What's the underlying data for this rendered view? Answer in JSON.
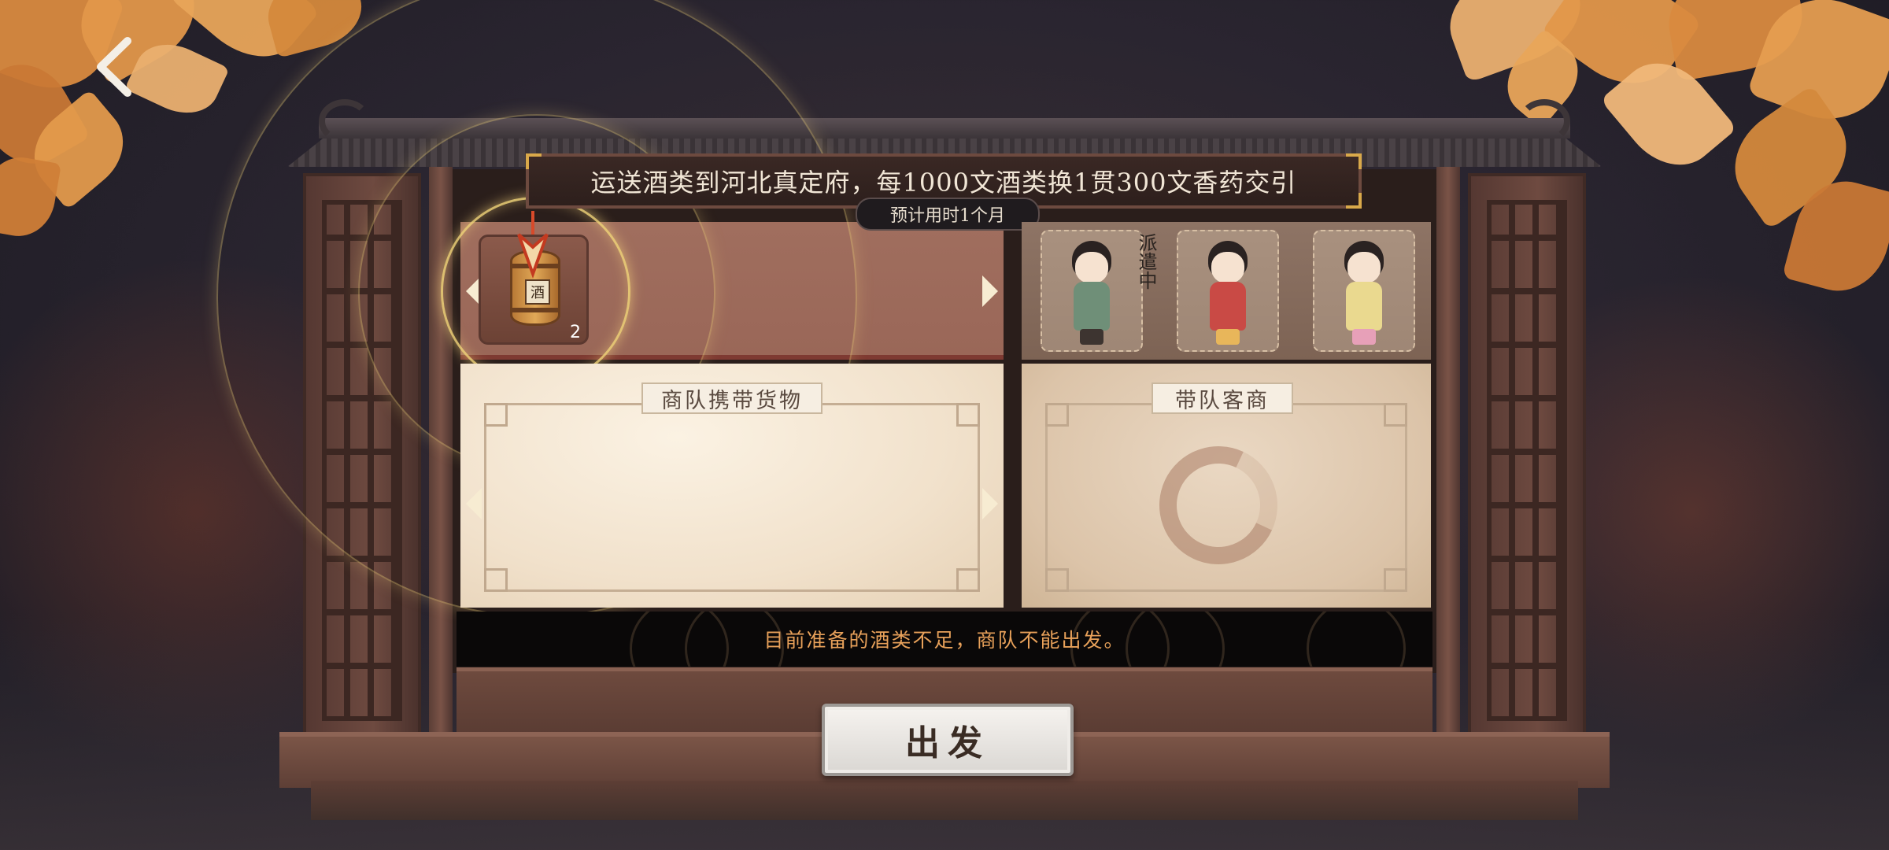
{
  "quest": {
    "title": "运送酒类到河北真定府，每1000文酒类换1贯300文香药交引",
    "duration": "预计用时1个月"
  },
  "goods_selector": {
    "selected_item": {
      "icon": "wine-barrel-icon",
      "label": "酒",
      "count": "2"
    }
  },
  "merchants": [
    {
      "name": "merchant-1",
      "status": "派遣中",
      "color": "#6f8f78"
    },
    {
      "name": "merchant-2",
      "status": "",
      "color": "#c94a45"
    },
    {
      "name": "merchant-3",
      "status": "",
      "color": "#ead98f"
    }
  ],
  "panels": {
    "cargo_label": "商队携带货物",
    "merchant_label": "带队客商"
  },
  "status": {
    "message": "目前准备的酒类不足，商队不能出发。"
  },
  "actions": {
    "depart_label": "出发"
  },
  "colors": {
    "accent_orange": "#e8a15a",
    "wood": "#6e4a3e",
    "highlight_ring": "#eed278"
  }
}
